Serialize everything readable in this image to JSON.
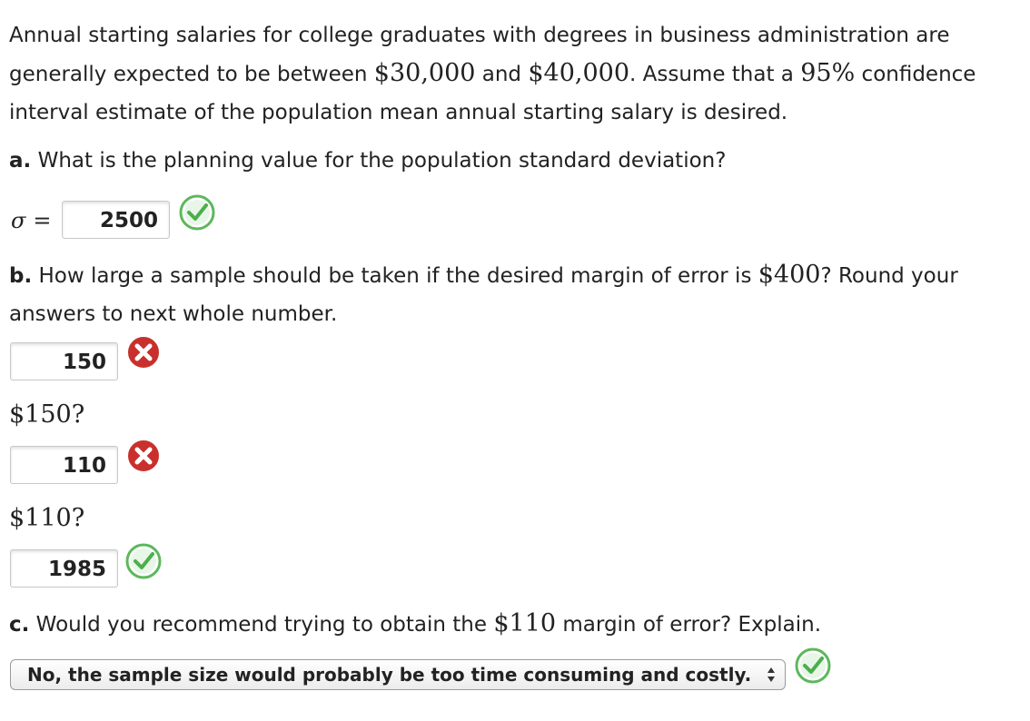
{
  "intro": {
    "t1": "Annual starting salaries for college graduates with degrees in business administration are generally expected to be between ",
    "v1": "$30,000",
    "t2": " and ",
    "v2": "$40,000",
    "t3": ". Assume that a ",
    "v3": "95%",
    "t4": " confidence interval estimate of the population mean annual starting salary is desired."
  },
  "part_a": {
    "label": "a.",
    "question": " What is the planning value for the population standard deviation?",
    "sigma_symbol": "σ",
    "equals": "=",
    "answer": "2500",
    "status": "correct"
  },
  "part_b": {
    "label": "b.",
    "q1": " How large a sample should be taken if the desired margin of error is ",
    "v1": "$400",
    "q2": "? Round your answers to next whole number.",
    "answers": [
      {
        "value": "150",
        "status": "incorrect"
      },
      {
        "prompt": "$150?",
        "value": "110",
        "status": "incorrect"
      },
      {
        "prompt": "$110?",
        "value": "1985",
        "status": "correct"
      }
    ]
  },
  "part_c": {
    "label": "c.",
    "q1": " Would you recommend trying to obtain the ",
    "v1": "$110",
    "q2": " margin of error? Explain.",
    "selected_option": "No, the sample size would probably be too time consuming and costly.",
    "status": "correct"
  },
  "colors": {
    "correct": "#5cb85c",
    "incorrect": "#c9302c",
    "text": "#222222"
  },
  "icons": {
    "correct": "check-circle-icon",
    "incorrect": "x-circle-icon",
    "select": "updown-arrows-icon"
  }
}
